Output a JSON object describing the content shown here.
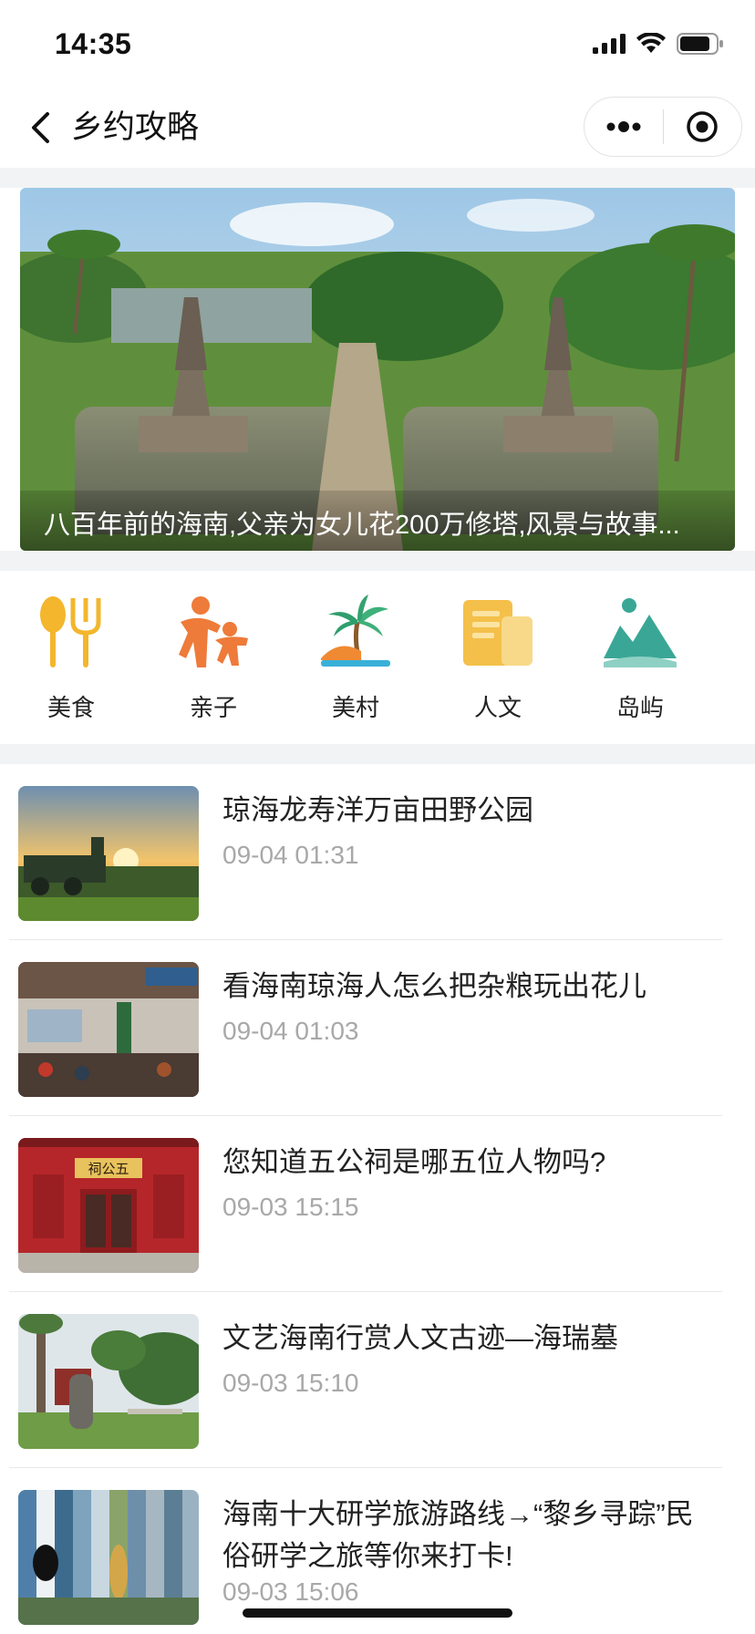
{
  "status": {
    "time": "14:35"
  },
  "nav": {
    "title": "乡约攻略"
  },
  "banner": {
    "caption": "八百年前的海南,父亲为女儿花200万修塔,风景与故事..."
  },
  "categories": [
    {
      "label": "美食",
      "icon": "food-icon",
      "color": "#f3b62c"
    },
    {
      "label": "亲子",
      "icon": "parent-child-icon",
      "color": "#ee7b3a"
    },
    {
      "label": "美村",
      "icon": "village-palm-icon",
      "color": "#3fae8f"
    },
    {
      "label": "人文",
      "icon": "culture-book-icon",
      "color": "#f4c04a"
    },
    {
      "label": "岛屿",
      "icon": "island-icon",
      "color": "#3aa796"
    }
  ],
  "articles": [
    {
      "title": "琼海龙寿洋万亩田野公园",
      "time": "09-04 01:31"
    },
    {
      "title": "看海南琼海人怎么把杂粮玩出花儿",
      "time": "09-04 01:03"
    },
    {
      "title": "您知道五公祠是哪五位人物吗?",
      "time": "09-03 15:15"
    },
    {
      "title": "文艺海南行赏人文古迹—海瑞墓",
      "time": "09-03 15:10"
    },
    {
      "title": "海南十大研学旅游路线→“黎乡寻踪”民俗研学之旅等你来打卡!",
      "time": "09-03 15:06"
    }
  ],
  "thumb_signs": {
    "temple": "祠公五"
  }
}
